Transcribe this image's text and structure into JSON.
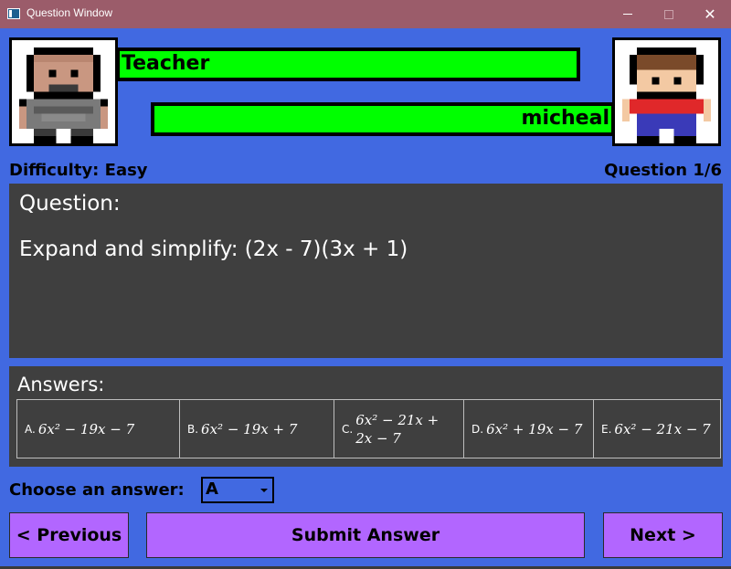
{
  "window": {
    "title": "Question Window",
    "minimize_label": "minimize",
    "maximize_label": "maximize",
    "close_label": "close"
  },
  "players": {
    "teacher": {
      "name": "Teacher",
      "health": 1.0,
      "bar_color": "#00ff00"
    },
    "student": {
      "name": "micheal",
      "health": 1.0,
      "bar_color": "#00ff00"
    }
  },
  "status": {
    "difficulty": "Difficulty: Easy",
    "question_counter": "Question 1/6"
  },
  "question": {
    "heading": "Question:",
    "text": "Expand and simplify: (2x - 7)(3x + 1)"
  },
  "answers": {
    "heading": "Answers:",
    "options": [
      {
        "letter": "A.",
        "expr": "6x² − 19x − 7"
      },
      {
        "letter": "B.",
        "expr": "6x² − 19x + 7"
      },
      {
        "letter": "C.",
        "expr": "6x² − 21x + 2x − 7"
      },
      {
        "letter": "D.",
        "expr": "6x² + 19x − 7"
      },
      {
        "letter": "E.",
        "expr": "6x² − 21x − 7"
      }
    ]
  },
  "choose": {
    "label": "Choose an answer:",
    "selected": "A"
  },
  "buttons": {
    "previous": "< Previous",
    "submit": "Submit Answer",
    "next": "Next >"
  },
  "colors": {
    "background": "#4169e1",
    "titlebar": "#9b5c6a",
    "panel": "#3f3f3f",
    "button": "#b266ff",
    "health": "#00ff00"
  }
}
